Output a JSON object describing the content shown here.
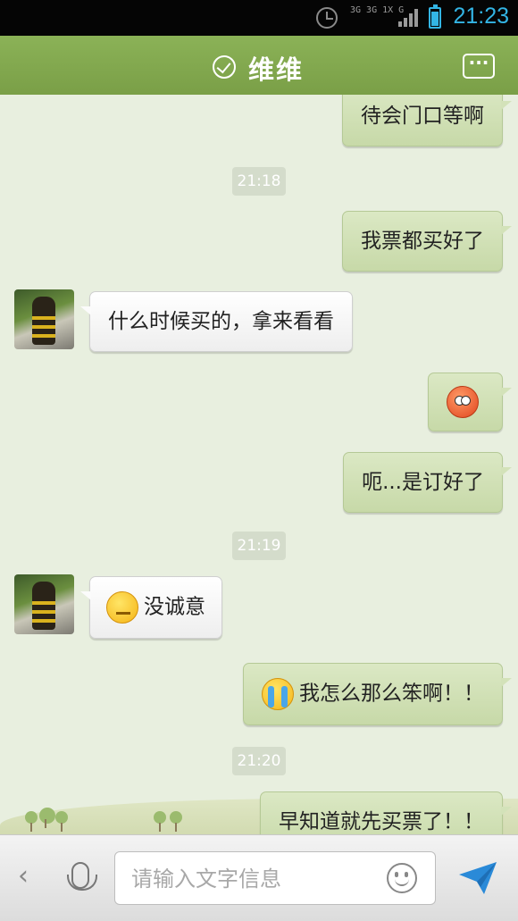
{
  "status_bar": {
    "time": "21:23",
    "network_text": "3G 3G 1X G",
    "icons": [
      "alarm-icon",
      "signal-icon",
      "battery-icon"
    ]
  },
  "header": {
    "contact_name": "维维",
    "status_icon": "check-circle-icon",
    "menu_icon": "more-icon",
    "menu_label": "···"
  },
  "messages": [
    {
      "type": "out",
      "text": "待会门口等啊"
    },
    {
      "type": "time",
      "text": "21:18"
    },
    {
      "type": "out",
      "text": "我票都买好了"
    },
    {
      "type": "in",
      "text": "什么时候买的，拿来看看"
    },
    {
      "type": "out",
      "emoji": "angry-face-icon",
      "text": ""
    },
    {
      "type": "out",
      "text": "呃...是订好了"
    },
    {
      "type": "time",
      "text": "21:19"
    },
    {
      "type": "in",
      "emoji": "sulky-face-icon",
      "text": "没诚意"
    },
    {
      "type": "out",
      "emoji": "crying-face-icon",
      "text": "我怎么那么笨啊！！"
    },
    {
      "type": "time",
      "text": "21:20"
    },
    {
      "type": "out",
      "text": "早知道就先买票了！！"
    }
  ],
  "input_bar": {
    "placeholder": "请输入文字信息",
    "back_label": "‹",
    "icons": [
      "back-chevron-icon",
      "microphone-icon",
      "emoji-smile-icon",
      "send-icon"
    ]
  },
  "colors": {
    "header_green": "#7fa64b",
    "outgoing_bubble": "#cfdfb3",
    "incoming_bubble": "#ffffff",
    "chat_bg": "#e8efdf",
    "clock_blue": "#33b5e5"
  }
}
